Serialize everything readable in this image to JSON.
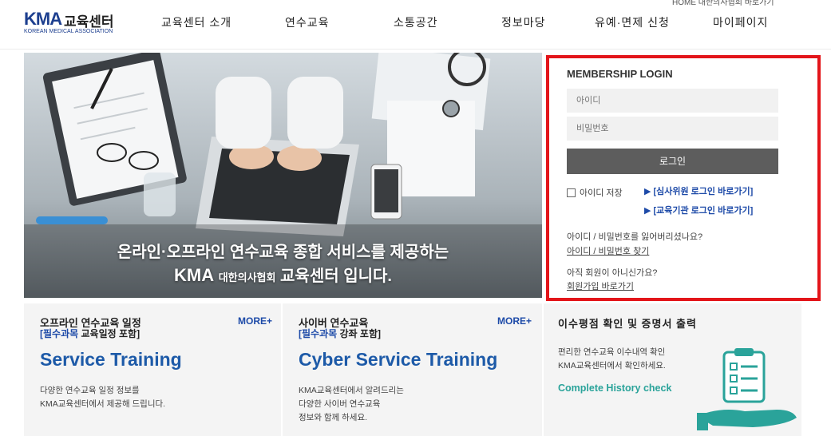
{
  "logo": {
    "kma": "KMA",
    "center": "교육센터",
    "sub": "KOREAN MEDICAL ASSOCIATION"
  },
  "top_util": "HOME   대한의사협회 바로가기",
  "nav": [
    {
      "label": "교육센터 소개"
    },
    {
      "label": "연수교육"
    },
    {
      "label": "소통공간"
    },
    {
      "label": "정보마당"
    },
    {
      "label": "유예·면제 신청"
    },
    {
      "label": "마이페이지"
    }
  ],
  "hero": {
    "line1": "온라인·오프라인 연수교육 종합 서비스를 제공하는",
    "kma": "KMA",
    "assoc": "대한의사협회",
    "line2_tail": "교육센터 입니다."
  },
  "login": {
    "title": "MEMBERSHIP LOGIN",
    "id_placeholder": "아이디",
    "pw_placeholder": "비밀번호",
    "button": "로그인",
    "save_id": "아이디 저장",
    "reviewer_link": "[심사위원 로그인 바로가기]",
    "org_link": "[교육기관 로그인 바로가기]",
    "lost_q": "아이디 / 비밀번호를 잃어버리셨나요?",
    "lost_a": "아이디 / 비밀번호 찾기",
    "join_q": "아직 회원이 아니신가요?",
    "join_a": "회원가입 바로가기"
  },
  "panels": {
    "offline": {
      "title": "오프라인 연수교육 일정",
      "sub_hl": "[필수과목",
      "sub_rest": " 교육일정 포함]",
      "more": "MORE+",
      "big": "Service Training",
      "desc1": "다양한 연수교육 일정 정보를",
      "desc2": "KMA교육센터에서 제공해 드립니다."
    },
    "cyber": {
      "title": "사이버 연수교육",
      "sub_hl": "[필수과목",
      "sub_rest": " 강좌 포함]",
      "more": "MORE+",
      "big": "Cyber Service Training",
      "desc1": "KMA교육센터에서 알려드리는",
      "desc2": "다양한 사이버 연수교육",
      "desc3": "정보와 함께 하세요."
    },
    "history": {
      "title": "이수평점 확인 및 증명서 출력",
      "desc1": "편리한 연수교육 이수내역 확인",
      "desc2": "KMA교육센터에서 확인하세요.",
      "link": "Complete History check"
    }
  }
}
